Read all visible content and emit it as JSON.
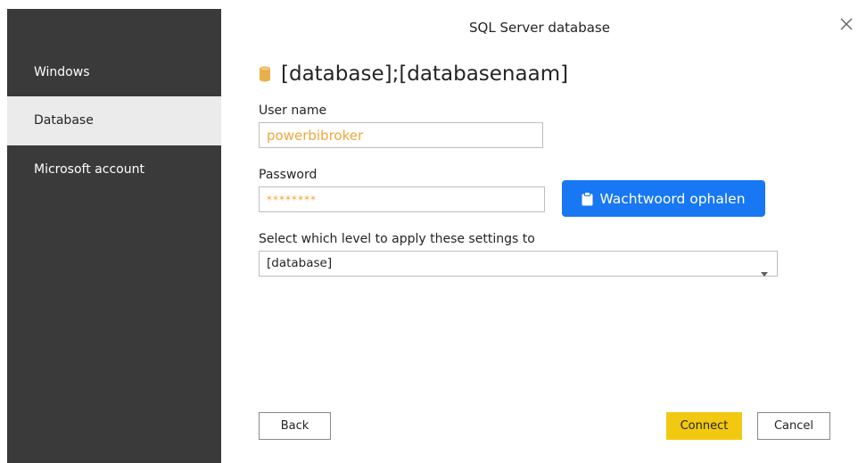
{
  "dialog": {
    "title": "SQL Server database",
    "close_icon": "close-icon"
  },
  "sidebar": {
    "items": [
      {
        "label": "Windows",
        "active": false
      },
      {
        "label": "Database",
        "active": true
      },
      {
        "label": "Microsoft account",
        "active": false
      }
    ]
  },
  "main": {
    "heading": "[database];[databasenaam]",
    "heading_icon": "database-icon",
    "username_label": "User name",
    "username_value": "powerbibroker",
    "password_label": "Password",
    "password_value": "********",
    "fetch_button_label": "Wachtwoord ophalen",
    "fetch_button_icon": "clipboard-icon",
    "level_label": "Select which level to apply these settings to",
    "level_selected": "[database]"
  },
  "footer": {
    "back_label": "Back",
    "connect_label": "Connect",
    "cancel_label": "Cancel"
  },
  "colors": {
    "sidebar_bg": "#3a3a3a",
    "sidebar_active_bg": "#ebebeb",
    "accent_blue": "#1877f2",
    "connect_yellow": "#f2c811",
    "input_value_orange": "#f0a63a",
    "database_icon": "#e8b04a"
  }
}
